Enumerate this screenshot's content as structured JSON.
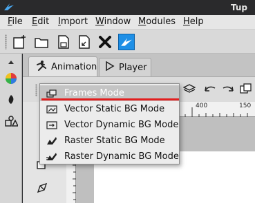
{
  "window": {
    "title": "Tup",
    "logo_icon": "tupi-bird-icon"
  },
  "menubar": {
    "items": [
      "File",
      "Edit",
      "Import",
      "Window",
      "Modules",
      "Help"
    ]
  },
  "toolbar": {
    "buttons": [
      "new-project-icon",
      "open-folder-icon",
      "save-document-icon",
      "export-document-icon",
      "close-x-icon",
      "tupi-app-icon"
    ]
  },
  "tabs": {
    "animation": "Animation",
    "player": "Player"
  },
  "ruler": {
    "labels": [
      "400",
      "150"
    ]
  },
  "modes_menu": {
    "items": [
      {
        "label": "Frames Mode",
        "icon": "frames-mode-icon",
        "selected": true
      },
      {
        "label": "Vector Static BG Mode",
        "icon": "vector-static-icon"
      },
      {
        "label": "Vector Dynamic BG Mode",
        "icon": "vector-dynamic-icon"
      },
      {
        "label": "Raster Static BG Mode",
        "icon": "raster-static-icon"
      },
      {
        "label": "Raster Dynamic BG Mode",
        "icon": "raster-dynamic-icon"
      }
    ]
  },
  "colors": {
    "titlebar": "#2a2a2c",
    "accent_blue": "#1e8fe6",
    "highlight_red": "#e21e1e",
    "selected_row": "#c4c4c4"
  }
}
